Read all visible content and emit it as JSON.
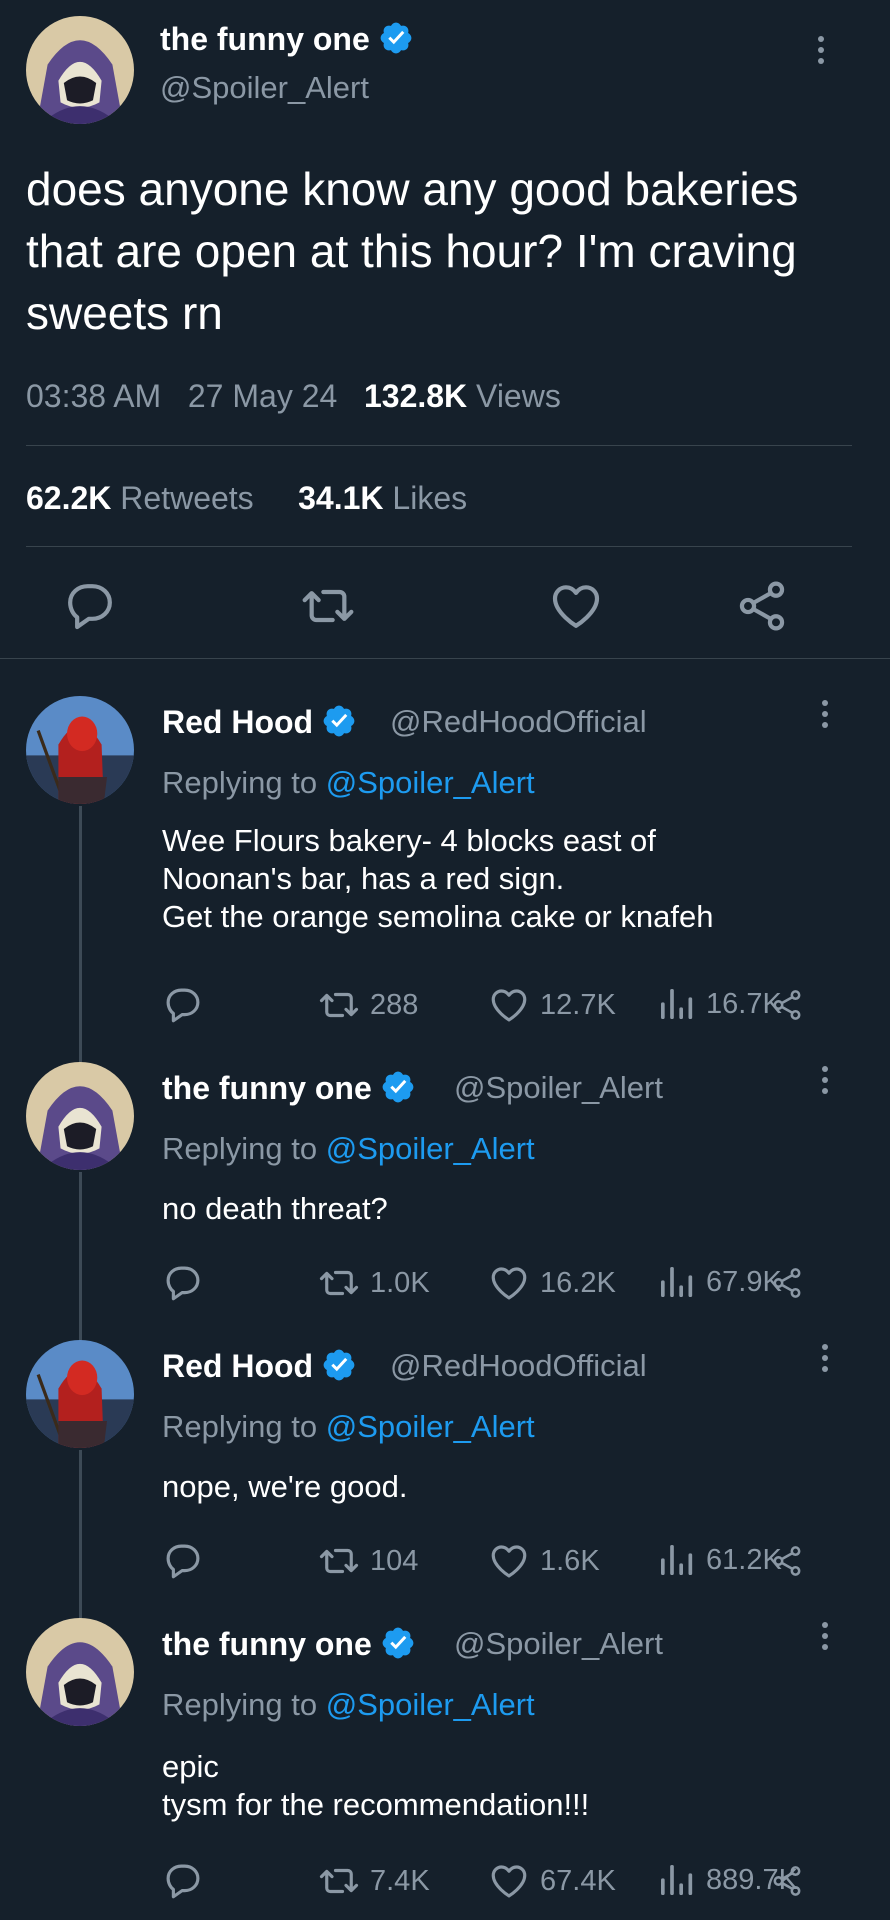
{
  "main_tweet": {
    "display_name": "the funny one",
    "handle": "@Spoiler_Alert",
    "text": "does anyone know any good bakeries that are open at this hour? I'm craving sweets rn",
    "time": "03:38 AM",
    "date": "27 May 24",
    "views_count": "132.8K",
    "views_label": "Views",
    "retweets_count": "62.2K",
    "retweets_label": "Retweets",
    "likes_count": "34.1K",
    "likes_label": "Likes"
  },
  "replies": [
    {
      "display_name": "Red Hood",
      "handle": "@RedHoodOfficial",
      "replying_prefix": "Replying to",
      "replying_to": "@Spoiler_Alert",
      "text": "Wee Flours bakery- 4 blocks east of\nNoonan's bar, has a red sign.\nGet the orange semolina cake or knafeh",
      "retweets": "288",
      "likes": "12.7K",
      "views": "16.7K"
    },
    {
      "display_name": "the funny one",
      "handle": "@Spoiler_Alert",
      "replying_prefix": "Replying to",
      "replying_to": "@Spoiler_Alert",
      "text": "no death threat?",
      "retweets": "1.0K",
      "likes": "16.2K",
      "views": "67.9K"
    },
    {
      "display_name": "Red Hood",
      "handle": "@RedHoodOfficial",
      "replying_prefix": "Replying to",
      "replying_to": "@Spoiler_Alert",
      "text": "nope, we're good.",
      "retweets": "104",
      "likes": "1.6K",
      "views": "61.2K"
    },
    {
      "display_name": "the funny one",
      "handle": "@Spoiler_Alert",
      "replying_prefix": "Replying to",
      "replying_to": "@Spoiler_Alert",
      "text": "epic\ntysm for the recommendation!!!",
      "retweets": "7.4K",
      "likes": "67.4K",
      "views": "889.7K"
    }
  ],
  "colors": {
    "background": "#15202b",
    "text": "#ffffff",
    "secondary": "#8b98a5",
    "accent": "#1d9bf0",
    "divider": "#38444d"
  },
  "icons": [
    "verified-badge-icon",
    "more-icon",
    "reply-icon",
    "retweet-icon",
    "like-icon",
    "share-icon",
    "views-icon"
  ]
}
